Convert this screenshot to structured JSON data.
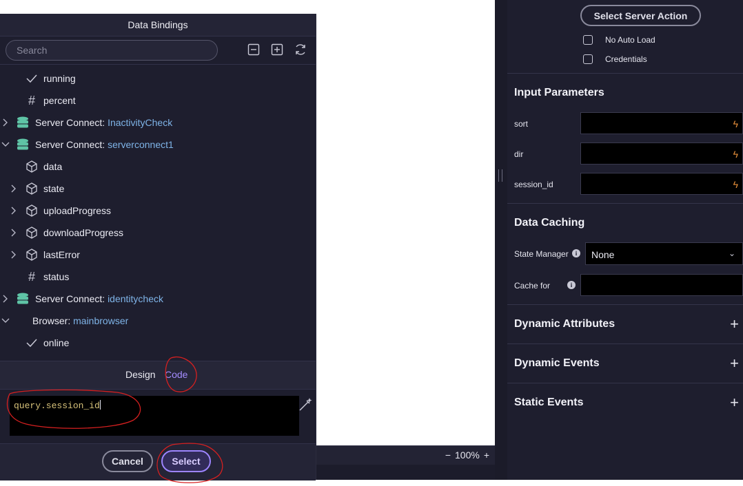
{
  "dialog": {
    "title": "Data Bindings",
    "search_placeholder": "Search",
    "toolbar_icons": [
      "collapse-all-icon",
      "expand-all-icon",
      "refresh-icon"
    ],
    "tree": [
      {
        "icon": "check-icon",
        "label": "running",
        "highlight": ""
      },
      {
        "icon": "hash-icon",
        "label": "percent",
        "highlight": ""
      },
      {
        "icon": "database-icon",
        "label": "Server Connect: ",
        "highlight": "InactivityCheck",
        "expanded": false
      },
      {
        "icon": "database-icon",
        "label": "Server Connect: ",
        "highlight": "serverconnect1",
        "expanded": true
      },
      {
        "icon": "cube-icon",
        "label": "data",
        "highlight": ""
      },
      {
        "icon": "cube-icon",
        "label": "state",
        "highlight": "",
        "expanded": false
      },
      {
        "icon": "cube-icon",
        "label": "uploadProgress",
        "highlight": "",
        "expanded": false
      },
      {
        "icon": "cube-icon",
        "label": "downloadProgress",
        "highlight": "",
        "expanded": false
      },
      {
        "icon": "cube-icon",
        "label": "lastError",
        "highlight": "",
        "expanded": false
      },
      {
        "icon": "hash-icon",
        "label": "status",
        "highlight": ""
      },
      {
        "icon": "database-icon",
        "label": "Server Connect: ",
        "highlight": "identitycheck",
        "expanded": false
      },
      {
        "icon": "",
        "label": "Browser: ",
        "highlight": "mainbrowser",
        "expanded": true
      },
      {
        "icon": "check-icon",
        "label": "online",
        "highlight": ""
      }
    ],
    "tabs": {
      "design": "Design",
      "code": "Code"
    },
    "code_value": "query.session_id",
    "cancel_label": "Cancel",
    "select_label": "Select"
  },
  "status": {
    "zoom": "100%",
    "zoom_minus": "−",
    "zoom_plus": "+"
  },
  "panel": {
    "server_action_label": "Select Server Action",
    "no_auto_load": "No Auto Load",
    "credentials": "Credentials",
    "input_params_title": "Input Parameters",
    "params": [
      "sort",
      "dir",
      "session_id"
    ],
    "data_caching_title": "Data Caching",
    "state_manager_label": "State Manager",
    "state_manager_value": "None",
    "cache_for_label": "Cache for",
    "dynamic_attributes": "Dynamic Attributes",
    "dynamic_events": "Dynamic Events",
    "static_events": "Static Events"
  },
  "colors": {
    "accent": "#9d85ff",
    "highlight": "#7fb4e8",
    "bolt": "#e8903a",
    "annotation": "#d62020"
  }
}
